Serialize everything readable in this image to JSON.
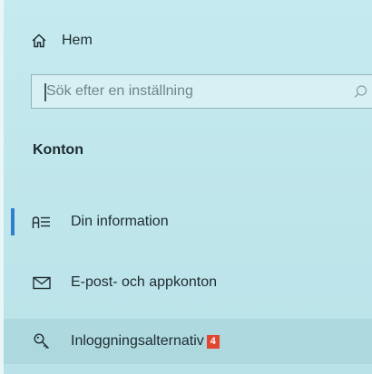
{
  "nav": {
    "home_label": "Hem",
    "home_icon": "home-icon"
  },
  "search": {
    "placeholder": "Sök efter en inställning",
    "icon": "search-icon"
  },
  "section": {
    "title": "Konton"
  },
  "items": [
    {
      "label": "Din information",
      "icon": "person-info-icon",
      "selected": true
    },
    {
      "label": "E-post- och appkonton",
      "icon": "mail-icon",
      "selected": false
    },
    {
      "label": "Inloggningsalternativ",
      "icon": "key-icon",
      "selected": false,
      "badge": "4"
    }
  ],
  "colors": {
    "accent": "#2f7fd0",
    "badge": "#e2462e",
    "background": "#bfe6ec"
  }
}
